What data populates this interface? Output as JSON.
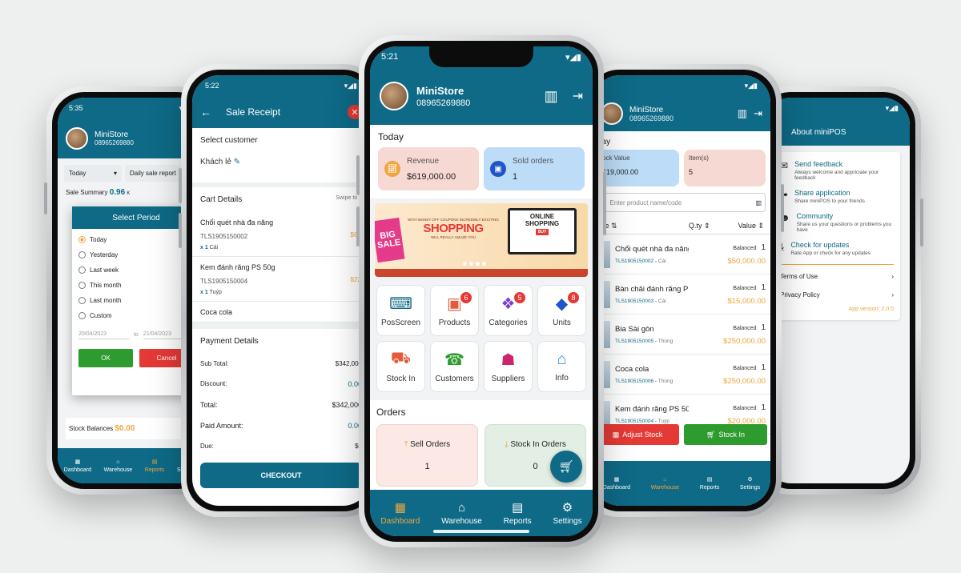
{
  "app": {
    "name": "MiniStore",
    "phone": "08965269880",
    "status_time_center": "5:21",
    "status_time_left2": "5:22",
    "status_time_left1": "5:35"
  },
  "nav": {
    "dashboard": "Dashboard",
    "warehouse": "Warehouse",
    "reports": "Reports",
    "settings": "Settings"
  },
  "dashboard": {
    "today": "Today",
    "revenue_label": "Revenue",
    "revenue_value": "$619,000.00",
    "sold_label": "Sold orders",
    "sold_value": "1",
    "banner": {
      "small": "WITH MONEY OFF COUPONS INCREDIBLY EXCITING",
      "shopping": "SHOPPING",
      "sub": "WILL REALLY AMAZE YOU",
      "big": "BIG",
      "sale": "SALE",
      "online": "ONLINE",
      "shopping2": "SHOPPING",
      "buy": "BUY"
    },
    "tiles": [
      {
        "label": "PosScreen",
        "badge": ""
      },
      {
        "label": "Products",
        "badge": "6"
      },
      {
        "label": "Categories",
        "badge": "5"
      },
      {
        "label": "Units",
        "badge": "8"
      },
      {
        "label": "Stock In",
        "badge": ""
      },
      {
        "label": "Customers",
        "badge": ""
      },
      {
        "label": "Suppliers",
        "badge": ""
      },
      {
        "label": "Info",
        "badge": ""
      }
    ],
    "orders_title": "Orders",
    "sell_orders_label": "Sell Orders",
    "sell_orders_value": "1",
    "stockin_orders_label": "Stock In Orders",
    "stockin_orders_value": "0"
  },
  "receipt": {
    "title": "Sale Receipt",
    "select_customer": "Select customer",
    "customer": "Khách lẻ",
    "cart_details": "Cart Details",
    "swipe_hint": "Swipe to d",
    "items": [
      {
        "name": "Chổi quét nhà đa năng",
        "code": "TLS1905150002",
        "qty": "x 1",
        "unit": "Cái",
        "price": "$60,00"
      },
      {
        "name": "Kem đánh răng PS 50g",
        "code": "TLS1905150004",
        "qty": "x 1",
        "unit": "Tuýp",
        "price": "$22,00"
      },
      {
        "name": "Coca cola",
        "code": "",
        "qty": "",
        "unit": "",
        "price": ""
      }
    ],
    "payment_details": "Payment Details",
    "sub_total_label": "Sub Total:",
    "sub_total_value": "$342,000",
    "discount_label": "Discount:",
    "discount_value": "0.00",
    "total_label": "Total:",
    "total_value": "$342,000",
    "paid_label": "Paid Amount:",
    "paid_value": "0.00",
    "due_label": "Due:",
    "due_value": "$0",
    "checkout": "CHECKOUT"
  },
  "report": {
    "period_select": "Today",
    "report_select": "Daily sale report",
    "sale_summary_label": "Sale Summary",
    "sale_summary_value": "0.96",
    "sale_summary_unit": "K",
    "dialog_title": "Select Period",
    "options": [
      "Today",
      "Yesterday",
      "Last week",
      "This month",
      "Last month",
      "Custom"
    ],
    "date_from": "20/04/2023",
    "to": "to",
    "date_to": "21/04/2023",
    "ok": "OK",
    "cancel": "Cancel",
    "stock_balances_label": "Stock Balances",
    "stock_balances_value": "$0.00"
  },
  "warehouse": {
    "today": "day",
    "stock_value_label": "ock Value",
    "stock_value": "619,000.00",
    "items_label": "Item(s)",
    "items_value": "5",
    "search_placeholder": "Enter product name/code",
    "col_name": "me",
    "col_qty": "Q.ty",
    "col_value": "Value",
    "balanced": "Balanced",
    "products": [
      {
        "name": "Chổi quét nhà đa năng",
        "code": "TLS1905150002",
        "unit": "Cái",
        "qty": "1",
        "value": "$50,000.00"
      },
      {
        "name": "Bàn chải đánh răng PS",
        "code": "TLS1905150003",
        "unit": "Cái",
        "qty": "1",
        "value": "$15,000.00"
      },
      {
        "name": "Bia Sài gòn",
        "code": "TLS1905150005",
        "unit": "Thùng",
        "qty": "1",
        "value": "$250,000.00"
      },
      {
        "name": "Coca cola",
        "code": "TLS1905150006",
        "unit": "Thùng",
        "qty": "1",
        "value": "$250,000.00"
      },
      {
        "name": "Kem đánh răng PS 50g",
        "code": "TLS1905150004",
        "unit": "Tuýp",
        "qty": "1",
        "value": "$20,000.00"
      }
    ],
    "adjust_stock": "Adjust Stock",
    "stock_in": "Stock In"
  },
  "about": {
    "title": "About miniPOS",
    "send_feedback": "Send feedback",
    "send_feedback_desc": "Always welcome and appriciate your feedback",
    "share_app": "Share application",
    "share_app_desc": "Share miniPOS to your friends",
    "community": "Community",
    "community_desc": "Share us your questions or problems you have",
    "updates": "Check for updates",
    "updates_desc": "Rate App or check for any updates",
    "terms": "Terms of Use",
    "privacy": "Privacy Policy",
    "version": "App version: 2.0.0"
  },
  "colors": {
    "primary": "#0e6a86",
    "accent": "#f0a640",
    "danger": "#e53935",
    "success": "#2e9b2e"
  }
}
